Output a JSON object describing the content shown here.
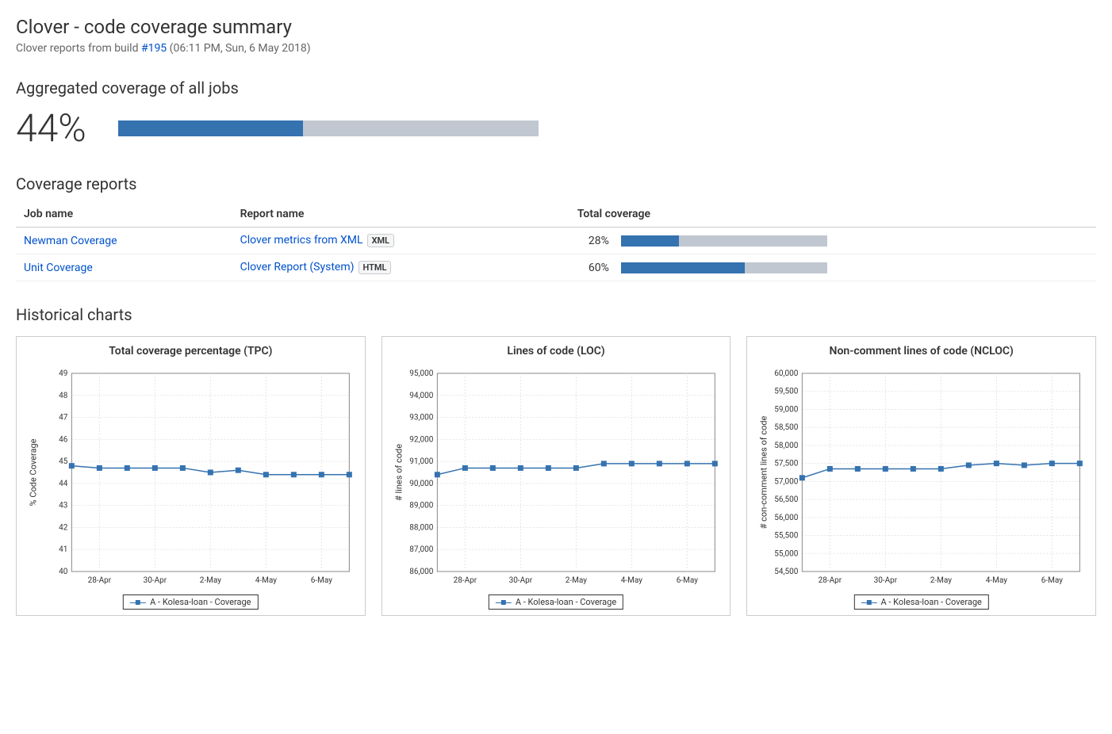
{
  "title": "Clover - code coverage summary",
  "subtitle_prefix": "Clover reports from build ",
  "build_link": "#195",
  "subtitle_suffix": " (06:11 PM, Sun, 6 May 2018)",
  "agg_heading": "Aggregated coverage of all jobs",
  "agg_pct": "44%",
  "agg_pct_value": 44,
  "reports_heading": "Coverage reports",
  "table": {
    "headers": [
      "Job name",
      "Report name",
      "Total coverage"
    ],
    "rows": [
      {
        "job": "Newman Coverage",
        "report": "Clover metrics from XML",
        "tag": "XML",
        "pct_label": "28%",
        "pct": 28
      },
      {
        "job": "Unit Coverage",
        "report": "Clover Report (System)",
        "tag": "HTML",
        "pct_label": "60%",
        "pct": 60
      }
    ]
  },
  "hist_heading": "Historical charts",
  "legend_label": "A - Kolesa-loan - Coverage",
  "chart_data": [
    {
      "type": "line",
      "title": "Total coverage percentage (TPC)",
      "ylabel": "% Code Coverage",
      "ylim": [
        40,
        49
      ],
      "yticks": [
        40,
        41,
        42,
        43,
        44,
        45,
        46,
        47,
        48,
        49
      ],
      "categories": [
        "28-Apr",
        "30-Apr",
        "2-May",
        "4-May",
        "6-May"
      ],
      "x": [
        0,
        1,
        2,
        3,
        4,
        5,
        6,
        7,
        8,
        9,
        10
      ],
      "series": [
        {
          "name": "A - Kolesa-loan - Coverage",
          "values": [
            44.8,
            44.7,
            44.7,
            44.7,
            44.7,
            44.5,
            44.6,
            44.4,
            44.4,
            44.4,
            44.4
          ]
        }
      ]
    },
    {
      "type": "line",
      "title": "Lines of code (LOC)",
      "ylabel": "# lines of code",
      "ylim": [
        86000,
        95000
      ],
      "yticks": [
        86000,
        87000,
        88000,
        89000,
        90000,
        91000,
        92000,
        93000,
        94000,
        95000
      ],
      "categories": [
        "28-Apr",
        "30-Apr",
        "2-May",
        "4-May",
        "6-May"
      ],
      "x": [
        0,
        1,
        2,
        3,
        4,
        5,
        6,
        7,
        8,
        9,
        10
      ],
      "series": [
        {
          "name": "A - Kolesa-loan - Coverage",
          "values": [
            90400,
            90700,
            90700,
            90700,
            90700,
            90700,
            90900,
            90900,
            90900,
            90900,
            90900
          ]
        }
      ]
    },
    {
      "type": "line",
      "title": "Non-comment lines of code (NCLOC)",
      "ylabel": "# con-comment lines of code",
      "ylim": [
        54500,
        60000
      ],
      "yticks": [
        54500,
        55000,
        55500,
        56000,
        56500,
        57000,
        57500,
        58000,
        58500,
        59000,
        59500,
        60000
      ],
      "categories": [
        "28-Apr",
        "30-Apr",
        "2-May",
        "4-May",
        "6-May"
      ],
      "x": [
        0,
        1,
        2,
        3,
        4,
        5,
        6,
        7,
        8,
        9,
        10
      ],
      "series": [
        {
          "name": "A - Kolesa-loan - Coverage",
          "values": [
            57100,
            57350,
            57350,
            57350,
            57350,
            57350,
            57450,
            57500,
            57450,
            57500,
            57500
          ]
        }
      ]
    }
  ]
}
